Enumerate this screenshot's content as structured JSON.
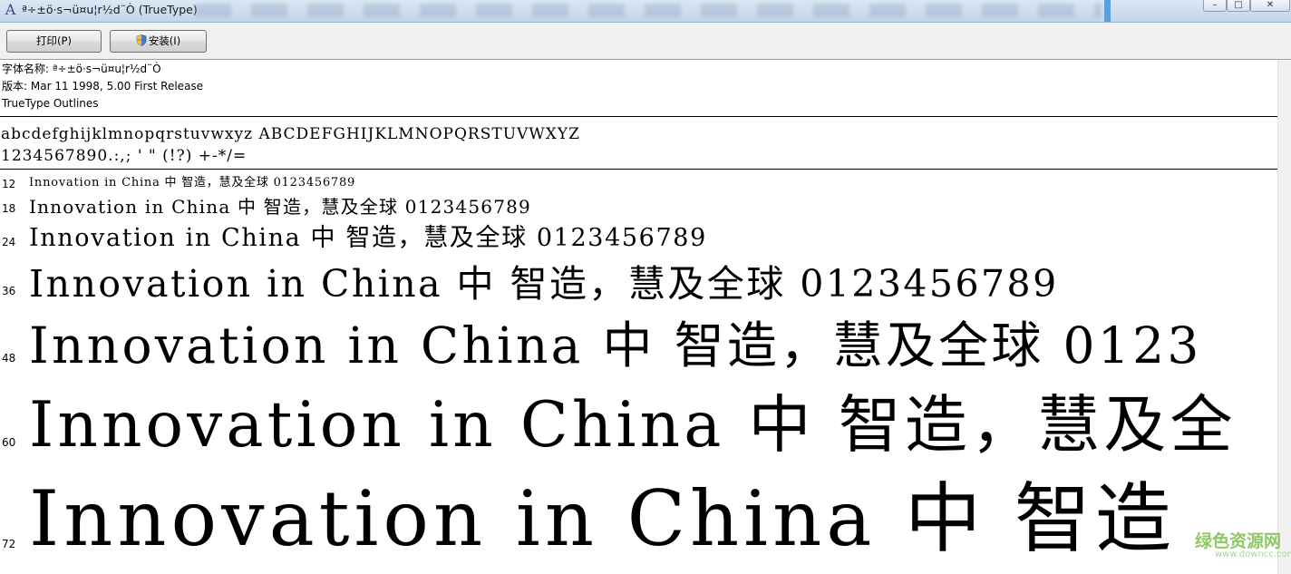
{
  "window": {
    "title": "ª÷±ö·s¬ü¤u¦r½d¨Ò (TrueType)",
    "app_icon": "font-viewer-icon"
  },
  "window_controls": {
    "minimize": "–",
    "maximize": "□",
    "close": "✕"
  },
  "toolbar": {
    "print_label": "打印(P)",
    "install_label": "安装(I)",
    "install_icon": "uac-shield-icon"
  },
  "font_info": {
    "name_line": "字体名称: ª÷±ö·s¬ü¤u¦r½d¨Ò",
    "version_line": "版本: Mar 11 1998, 5.00 First Release",
    "outline_line": "TrueType Outlines"
  },
  "charset": {
    "line1": "abcdefghijklmnopqrstuvwxyz ABCDEFGHIJKLMNOPQRSTUVWXYZ",
    "line2": "1234567890.:,; ' \" (!?) +-*/="
  },
  "samples": [
    {
      "size": "12",
      "text": "Innovation in China 中  智造，慧及全球 0123456789"
    },
    {
      "size": "18",
      "text": "Innovation in China 中  智造，慧及全球 0123456789"
    },
    {
      "size": "24",
      "text": "Innovation in China 中  智造，慧及全球 0123456789"
    },
    {
      "size": "36",
      "text": "Innovation in China 中  智造，慧及全球 0123456789"
    },
    {
      "size": "48",
      "text": "Innovation in China 中  智造，慧及全球 0123"
    },
    {
      "size": "60",
      "text": "Innovation in China 中  智造，慧及全"
    },
    {
      "size": "72",
      "text": "Innovation in China 中  智造"
    }
  ],
  "watermark": {
    "logo": "绿色资源网",
    "url": "www.downcc.com"
  },
  "colors": {
    "titlebar": "#c3d5ea",
    "toolbar": "#f0f0f0",
    "watermark": "#7cc04a"
  }
}
